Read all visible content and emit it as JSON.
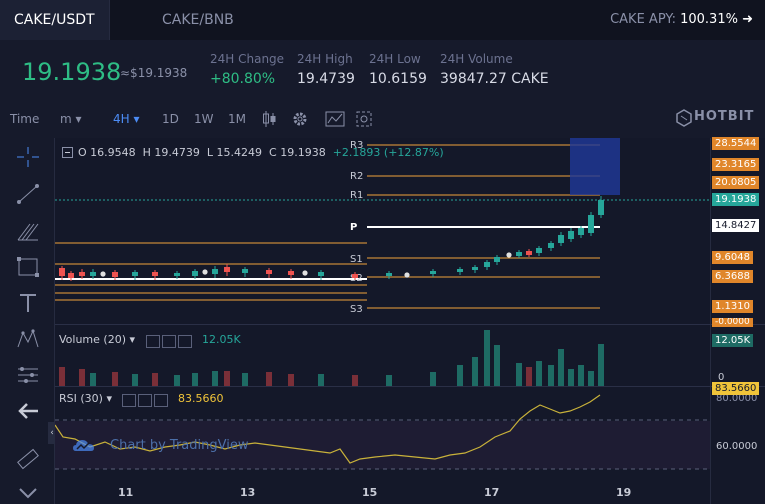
{
  "tabs": [
    {
      "label": "CAKE/USDT",
      "active": true
    },
    {
      "label": "CAKE/BNB",
      "active": false
    }
  ],
  "apy": {
    "label": "CAKE APY:",
    "value": "100.31%"
  },
  "stats": {
    "price": "19.1938",
    "price_usd": "≈$19.1938",
    "change_label": "24H Change",
    "change_value": "+80.80%",
    "high_label": "24H High",
    "high_value": "19.4739",
    "low_label": "24H Low",
    "low_value": "10.6159",
    "volume_label": "24H Volume",
    "volume_value": "39847.27 CAKE"
  },
  "toolbar": {
    "time": "Time",
    "minute": "m",
    "h4": "4H",
    "d1": "1D",
    "w1": "1W",
    "m1": "1M",
    "brand": "HOTBIT"
  },
  "ohlc": {
    "o": "O 16.9548",
    "h": "H 19.4739",
    "l": "L 15.4249",
    "c": "C 19.1938",
    "chg": "+2.1893 (+12.87%)"
  },
  "pivots": {
    "r3": "R3",
    "r2": "R2",
    "r1": "R1",
    "p": "P",
    "s1": "S1",
    "s2": "S2",
    "s3": "S3"
  },
  "price_labels": {
    "l1": "28.5544",
    "l2": "23.3165",
    "l3": "20.0805",
    "l4": "19.1938",
    "l5": "14.8427",
    "l6": "9.6048",
    "l7": "6.3688",
    "l8": "1.1310",
    "l9": "-0.0000"
  },
  "volume": {
    "title": "Volume (20)",
    "value": "12.05K",
    "axis_top": "12.05K",
    "axis_zero": "0"
  },
  "rsi": {
    "title": "RSI (30)",
    "value": "83.5660",
    "axis_top": "83.5660",
    "axis_80": "80.0000",
    "axis_60": "60.0000"
  },
  "watermark": "Chart by TradingView",
  "x_axis": [
    "11",
    "13",
    "15",
    "17",
    "19"
  ],
  "colors": {
    "up": "#26a69a",
    "down": "#ef5350",
    "accent": "#4c8cf5",
    "orange": "#f0a23a"
  }
}
